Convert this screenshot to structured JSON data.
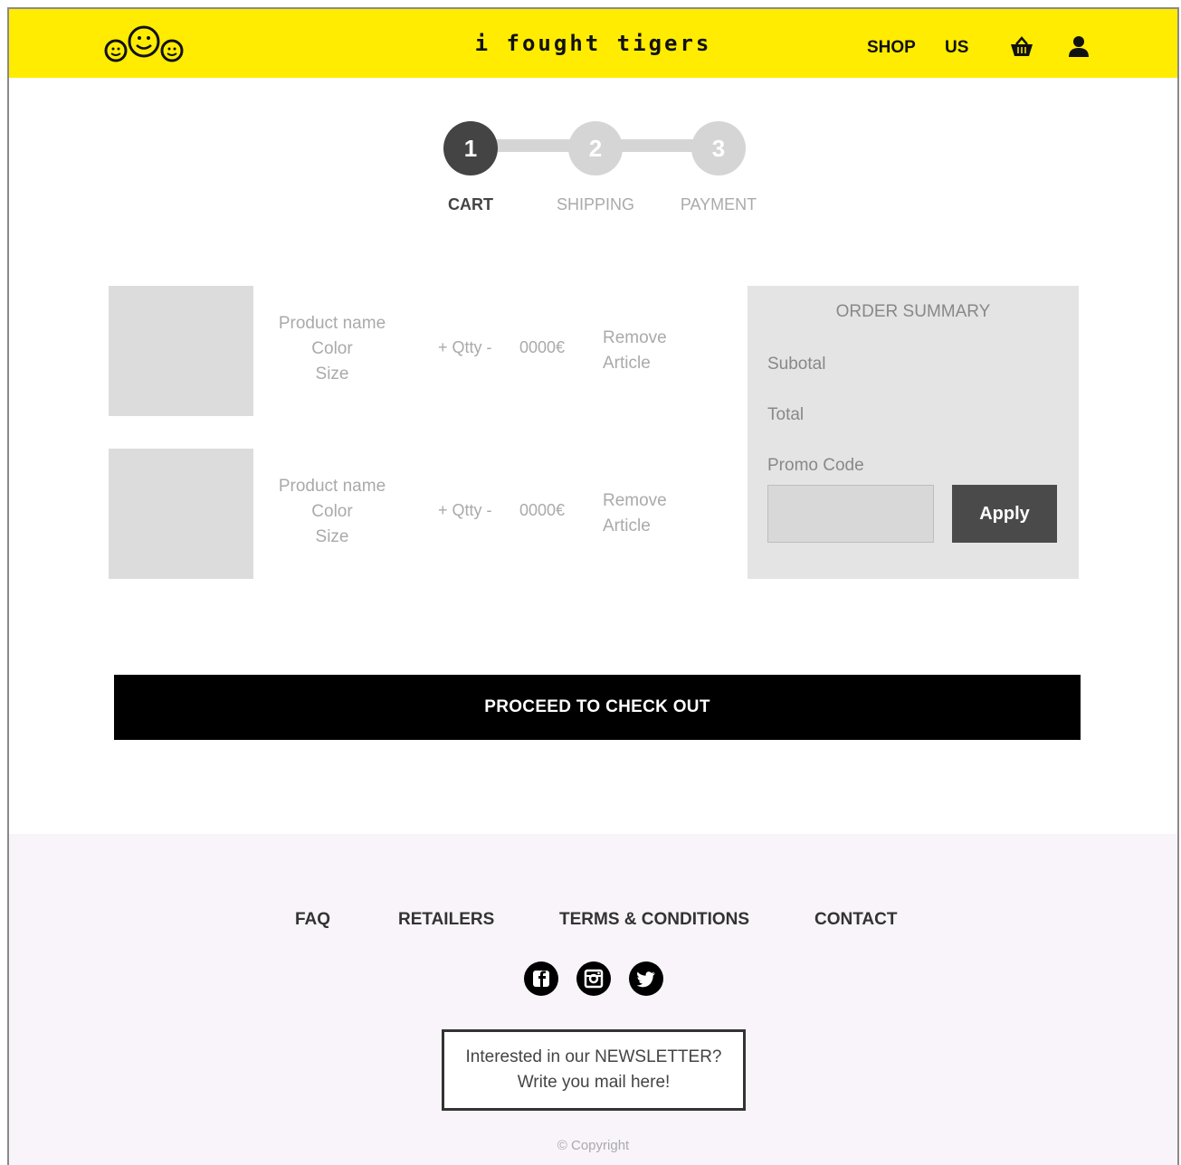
{
  "header": {
    "brand": "i fought tigers",
    "nav": {
      "shop": "SHOP",
      "us": "US"
    },
    "icons": [
      "logo-smiley-icon",
      "basket-icon",
      "user-icon"
    ],
    "accent_color": "#ffec00"
  },
  "steps": [
    {
      "number": "1",
      "label": "CART",
      "active": true
    },
    {
      "number": "2",
      "label": "SHIPPING",
      "active": false
    },
    {
      "number": "3",
      "label": "PAYMENT",
      "active": false
    }
  ],
  "cart": {
    "items": [
      {
        "name": "Product name",
        "color": "Color",
        "size": "Size",
        "qty": "+ Qtty -",
        "price": "0000€",
        "remove_line1": "Remove",
        "remove_line2": "Article"
      },
      {
        "name": "Product name",
        "color": "Color",
        "size": "Size",
        "qty": "+ Qtty -",
        "price": "0000€",
        "remove_line1": "Remove",
        "remove_line2": "Article"
      }
    ]
  },
  "summary": {
    "title": "ORDER SUMMARY",
    "subtotal_label": "Subotal",
    "total_label": "Total",
    "promo_label": "Promo Code",
    "promo_value": "",
    "apply_label": "Apply"
  },
  "checkout": {
    "label": "PROCEED TO CHECK OUT"
  },
  "footer": {
    "links": {
      "faq": "FAQ",
      "retailers": "RETAILERS",
      "terms": "TERMS & CONDITIONS",
      "contact": "CONTACT"
    },
    "social_icons": [
      "facebook-icon",
      "instagram-icon",
      "twitter-icon"
    ],
    "newsletter_line1": "Interested in our NEWSLETTER?",
    "newsletter_line2": "Write you mail here!",
    "copyright": "© Copyright",
    "background_color": "#f9f4fa"
  }
}
